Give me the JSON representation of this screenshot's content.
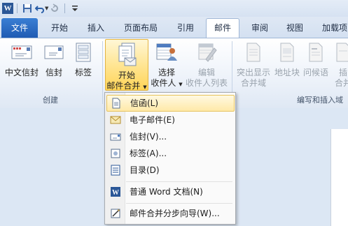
{
  "qat": {
    "app_icon": "W"
  },
  "tabs": [
    "文件",
    "开始",
    "插入",
    "页面布局",
    "引用",
    "邮件",
    "审阅",
    "视图",
    "加载项"
  ],
  "ribbon": {
    "create": {
      "items": [
        "中文信封",
        "信封",
        "标签"
      ],
      "label": "创建"
    },
    "start_merge": {
      "start_line1": "开始",
      "start_line2": "邮件合并",
      "select_line1": "选择",
      "select_line2": "收件人",
      "edit_line1": "编辑",
      "edit_line2": "收件人列表"
    },
    "write": {
      "highlight_line1": "突出显示",
      "highlight_line2": "合并域",
      "address_block": "地址块",
      "greeting_line": "问候语",
      "insert_line1": "插",
      "insert_line2": "合并",
      "label": "编写和插入域"
    }
  },
  "menu": {
    "items": [
      {
        "text": "信函(L)",
        "icon": "letter-icon"
      },
      {
        "text": "电子邮件(E)",
        "icon": "email-icon"
      },
      {
        "text": "信封(V)...",
        "icon": "envelope-icon"
      },
      {
        "text": "标签(A)...",
        "icon": "label-icon"
      },
      {
        "text": "目录(D)",
        "icon": "directory-icon"
      },
      {
        "text": "普通 Word 文档(N)",
        "icon": "word-doc-icon"
      },
      {
        "text": "邮件合并分步向导(W)...",
        "icon": "wizard-icon"
      }
    ]
  },
  "colors": {
    "accent": "#2b5797",
    "file_tab": "#2a6cc4",
    "highlight": "#ffe79a"
  }
}
